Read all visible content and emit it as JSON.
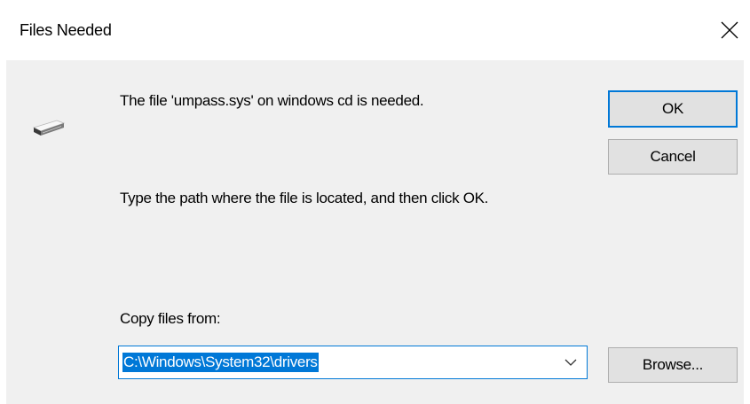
{
  "window": {
    "title": "Files Needed"
  },
  "message": {
    "file_needed": "The file 'umpass.sys' on windows cd is needed.",
    "instruction": "Type the path where the file is located, and then click OK."
  },
  "copy_from": {
    "label": "Copy files from:",
    "value": "C:\\Windows\\System32\\drivers"
  },
  "buttons": {
    "ok": "OK",
    "cancel": "Cancel",
    "browse": "Browse..."
  },
  "icons": {
    "close": "close-icon",
    "drive": "drive-icon",
    "dropdown": "chevron-down-icon"
  },
  "colors": {
    "accent": "#0078d7",
    "client_background": "#f0f0f0",
    "button_face": "#e1e1e1"
  }
}
